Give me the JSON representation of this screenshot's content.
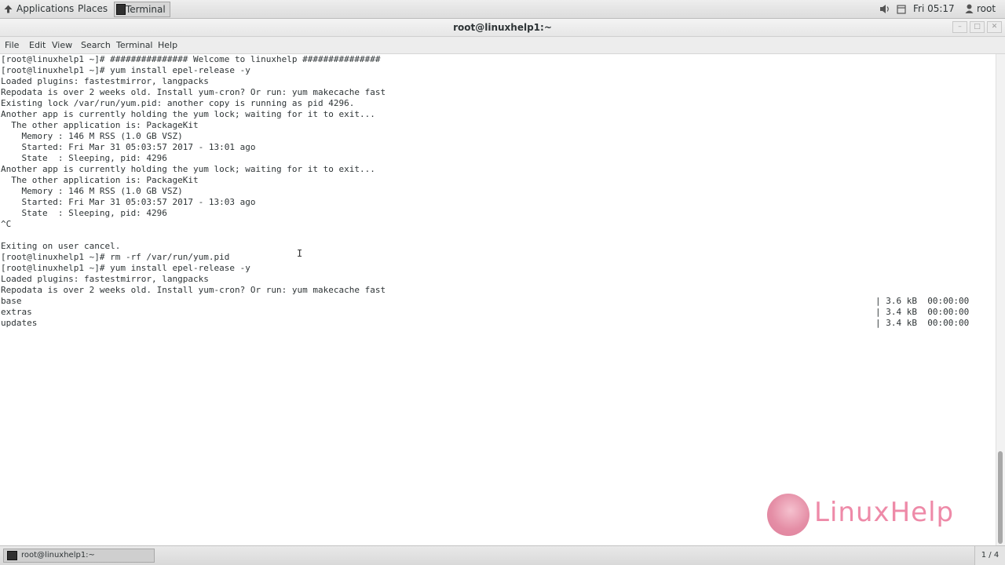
{
  "topbar": {
    "applications_label": "Applications",
    "places_label": "Places",
    "task_label": "Terminal",
    "clock": "Fri 05:17",
    "user": "root"
  },
  "window": {
    "title": "root@linuxhelp1:~",
    "minimize": "–",
    "maximize": "□",
    "close": "✕"
  },
  "menu": {
    "file": "File",
    "edit": "Edit",
    "view": "View",
    "search": "Search",
    "terminal": "Terminal",
    "help": "Help"
  },
  "terminal": {
    "lines": [
      "[root@linuxhelp1 ~]# ############### Welcome to linuxhelp ###############",
      "[root@linuxhelp1 ~]# yum install epel-release -y",
      "Loaded plugins: fastestmirror, langpacks",
      "Repodata is over 2 weeks old. Install yum-cron? Or run: yum makecache fast",
      "Existing lock /var/run/yum.pid: another copy is running as pid 4296.",
      "Another app is currently holding the yum lock; waiting for it to exit...",
      "  The other application is: PackageKit",
      "    Memory : 146 M RSS (1.0 GB VSZ)",
      "    Started: Fri Mar 31 05:03:57 2017 - 13:01 ago",
      "    State  : Sleeping, pid: 4296",
      "Another app is currently holding the yum lock; waiting for it to exit...",
      "  The other application is: PackageKit",
      "    Memory : 146 M RSS (1.0 GB VSZ)",
      "    Started: Fri Mar 31 05:03:57 2017 - 13:03 ago",
      "    State  : Sleeping, pid: 4296",
      "^C",
      "",
      "Exiting on user cancel.",
      "[root@linuxhelp1 ~]# rm -rf /var/run/yum.pid",
      "[root@linuxhelp1 ~]# yum install epel-release -y",
      "Loaded plugins: fastestmirror, langpacks",
      "Repodata is over 2 weeks old. Install yum-cron? Or run: yum makecache fast",
      "base",
      "extras",
      "updates"
    ],
    "right_lines": [
      "| 3.6 kB  00:00:00",
      "| 3.4 kB  00:00:00",
      "| 3.4 kB  00:00:00"
    ]
  },
  "watermark": "LinuxHelp",
  "taskbar": {
    "window_label": "root@linuxhelp1:~",
    "workspace": "1 / 4"
  }
}
